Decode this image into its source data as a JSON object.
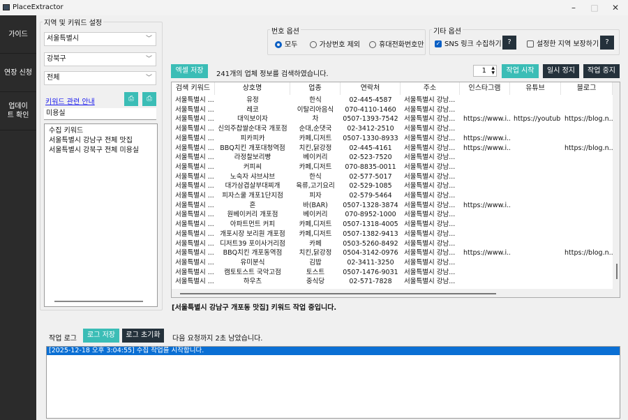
{
  "window": {
    "title": "PlaceExtractor"
  },
  "sidebar": {
    "items": [
      {
        "label": "가이드"
      },
      {
        "label": "연장 신청"
      },
      {
        "label": "업데이트 확인"
      }
    ]
  },
  "region": {
    "group_title": "지역 및 키워드 설정",
    "city": "서울특별시",
    "district": "강북구",
    "dong": "전체",
    "keyword_link": "키워드 관련 안내",
    "keyword_input": "미용실",
    "keyword_list": [
      "수집 키워드",
      "서울특별시 강남구 전체 맛집",
      "서울특별시 강북구 전체 미용실"
    ]
  },
  "number_options": {
    "title": "번호 옵션",
    "options": [
      {
        "label": "모두",
        "selected": true
      },
      {
        "label": "가상번호 제외",
        "selected": false
      },
      {
        "label": "휴대전화번호만",
        "selected": false
      }
    ]
  },
  "other_options": {
    "title": "기타 옵션",
    "sns": {
      "label": "SNS 링크 수집하기",
      "checked": true
    },
    "region_guard": {
      "label": "설정한 지역 보장하기",
      "checked": false
    },
    "help": "?"
  },
  "toolbar": {
    "excel_save": "엑셀 저장",
    "result_text": "241개의 업체 정보를 검색하였습니다.",
    "spin_value": "1",
    "start": "작업 시작",
    "pause": "일시 정지",
    "stop": "작업 중지"
  },
  "table": {
    "columns": [
      "검색 키워드",
      "상호명",
      "업종",
      "연락처",
      "주소",
      "인스타그램",
      "유튜브",
      "블로그"
    ],
    "rows": [
      [
        "서울특별시 ...",
        "유정",
        "한식",
        "02-445-4587",
        "서울특별시 강남...",
        "",
        "",
        ""
      ],
      [
        "서울특별시 ...",
        "레코",
        "이탈리아음식",
        "070-4110-1460",
        "서울특별시 강남...",
        "",
        "",
        ""
      ],
      [
        "서울특별시 ...",
        "대익보이자",
        "차",
        "0507-1393-7542",
        "서울특별시 강남...",
        "https://www.i...",
        "https://youtub...",
        "https://blog.n..."
      ],
      [
        "서울특별시 ...",
        "신의주찹쌀순대국 개포점",
        "순대,순댓국",
        "02-3412-2510",
        "서울특별시 강남...",
        "",
        "",
        ""
      ],
      [
        "서울특별시 ...",
        "피카피카",
        "카페,디저트",
        "0507-1330-8933",
        "서울특별시 강남...",
        "https://www.i...",
        "",
        ""
      ],
      [
        "서울특별시 ...",
        "BBQ치킨 개포대청역점",
        "치킨,닭강정",
        "02-445-4161",
        "서울특별시 강남...",
        "https://www.i...",
        "",
        "https://blog.n..."
      ],
      [
        "서울특별시 ...",
        "라정찰보리빵",
        "베이커리",
        "02-523-7520",
        "서울특별시 강남...",
        "",
        "",
        ""
      ],
      [
        "서울특별시 ...",
        "커피씨",
        "카페,디저트",
        "070-8835-0011",
        "서울특별시 강남...",
        "",
        "",
        ""
      ],
      [
        "서울특별시 ...",
        "노숙자 샤브샤브",
        "한식",
        "02-577-5017",
        "서울특별시 강남...",
        "",
        "",
        ""
      ],
      [
        "서울특별시 ...",
        "대가삼겹살부대찌개",
        "육류,고기요리",
        "02-529-1085",
        "서울특별시 강남...",
        "",
        "",
        ""
      ],
      [
        "서울특별시 ...",
        "피자스쿨 개포1단지점",
        "피자",
        "02-579-5464",
        "서울특별시 강남...",
        "",
        "",
        ""
      ],
      [
        "서울특별시 ...",
        "혼",
        "바(BAR)",
        "0507-1328-3874",
        "서울특별시 강남...",
        "https://www.i...",
        "",
        ""
      ],
      [
        "서울특별시 ...",
        "원베이커리 개포점",
        "베이커리",
        "070-8952-1000",
        "서울특별시 강남...",
        "",
        "",
        ""
      ],
      [
        "서울특별시 ...",
        "아파트먼트 커피",
        "카페,디저트",
        "0507-1318-4005",
        "서울특별시 강남...",
        "",
        "",
        ""
      ],
      [
        "서울특별시 ...",
        "개포시장 보리원 개포점",
        "카페,디저트",
        "0507-1382-9413",
        "서울특별시 강남...",
        "",
        "",
        ""
      ],
      [
        "서울특별시 ...",
        "디저트39 포이사거리점",
        "카페",
        "0503-5260-8492",
        "서울특별시 강남...",
        "",
        "",
        ""
      ],
      [
        "서울특별시 ...",
        "BBQ치킨 개포동역점",
        "치킨,닭강정",
        "0504-3142-0976",
        "서울특별시 강남...",
        "https://www.i...",
        "",
        "https://blog.n..."
      ],
      [
        "서울특별시 ...",
        "유미분식",
        "김밥",
        "02-3411-3250",
        "서울특별시 강남...",
        "",
        "",
        ""
      ],
      [
        "서울특별시 ...",
        "캠토토스트 국악고점",
        "토스트",
        "0507-1476-9031",
        "서울특별시 강남...",
        "",
        "",
        ""
      ],
      [
        "서울특별시 ...",
        "하우츠",
        "중식당",
        "02-571-7828",
        "서울특별시 강남...",
        "",
        "",
        ""
      ]
    ]
  },
  "status": {
    "current": "[서울특별시 강남구 개포동 맛집] 키워드 작업 중입니다."
  },
  "log": {
    "label": "작업 로그",
    "save": "로그 저장",
    "clear": "로그 초기화",
    "wait_text": "다음 요청까지 2초 남았습니다.",
    "entries": [
      "[2025-12-18 오후 3:04:55] 수집 작업를 시작합니다."
    ]
  },
  "colors": {
    "teal": "#3bbdb6",
    "dark": "#24313b",
    "sidebar": "#2b2b2b",
    "selection": "#0a6fd4"
  }
}
